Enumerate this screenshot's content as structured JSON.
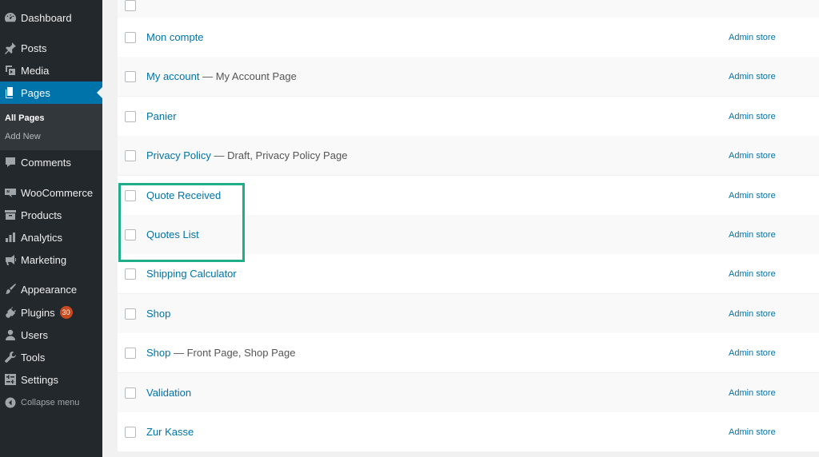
{
  "sidebar": {
    "dashboard": "Dashboard",
    "posts": "Posts",
    "media": "Media",
    "pages": "Pages",
    "all_pages": "All Pages",
    "add_new": "Add New",
    "comments": "Comments",
    "woocommerce": "WooCommerce",
    "products": "Products",
    "analytics": "Analytics",
    "marketing": "Marketing",
    "appearance": "Appearance",
    "plugins": "Plugins",
    "plugins_badge": "30",
    "users": "Users",
    "tools": "Tools",
    "settings": "Settings",
    "collapse": "Collapse menu"
  },
  "rows": [
    {
      "title": "Mon compte",
      "state": "",
      "author": "Admin store"
    },
    {
      "title": "My account",
      "state": " — My Account Page",
      "author": "Admin store"
    },
    {
      "title": "Panier",
      "state": "",
      "author": "Admin store"
    },
    {
      "title": "Privacy Policy",
      "state": " — Draft, Privacy Policy Page",
      "author": "Admin store"
    },
    {
      "title": "Quote Received",
      "state": "",
      "author": "Admin store"
    },
    {
      "title": "Quotes List",
      "state": "",
      "author": "Admin store"
    },
    {
      "title": "Shipping Calculator",
      "state": "",
      "author": "Admin store"
    },
    {
      "title": "Shop",
      "state": "",
      "author": "Admin store"
    },
    {
      "title": "Shop",
      "state": " — Front Page, Shop Page",
      "author": "Admin store"
    },
    {
      "title": "Validation",
      "state": "",
      "author": "Admin store"
    },
    {
      "title": "Zur Kasse",
      "state": "",
      "author": "Admin store"
    }
  ],
  "colors": {
    "sidebar_bg": "#23282d",
    "accent": "#0073aa",
    "highlight_box": "#20ad8a",
    "badge": "#ca4a1f"
  }
}
